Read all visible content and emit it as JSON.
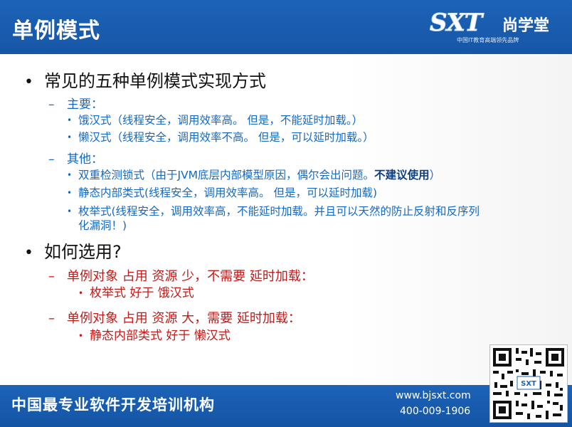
{
  "header": {
    "title": "单例模式",
    "logo_sxt": "SXT",
    "logo_cn": "尚学堂",
    "logo_tagline": "中国IT教育高端领先品牌"
  },
  "sections": [
    {
      "bullet": "常见的五种单例模式实现方式",
      "groups": [
        {
          "label": "主要：",
          "items": [
            "饿汉式（线程安全，调用效率高。 但是，不能延时加载。）",
            "懒汉式（线程安全，调用效率不高。 但是，可以延时加载。）"
          ]
        },
        {
          "label": "其他：",
          "items": [
            {
              "text": "双重检测锁式（由于JVM底层内部模型原因，偶尔会出问题。",
              "bold": "不建议使用",
              "tail": "）"
            },
            "静态内部类式(线程安全，调用效率高。 但是，可以延时加载)",
            {
              "line1": "枚举式(线程安全，调用效率高，不能延时加载。并且可以天然的防止反射和反序列",
              "line2": "化漏洞！)"
            }
          ]
        }
      ]
    },
    {
      "bullet": "如何选用?",
      "groups": [
        {
          "label": "单例对象  占用  资源 少，不需要  延时加载：",
          "items": [
            "枚举式   好于   饿汉式"
          ]
        },
        {
          "label": "单例对象  占用  资源 大，需要 延时加载：",
          "items": [
            "静态内部类式   好于   懒汉式"
          ]
        }
      ]
    }
  ],
  "footer": {
    "slogan": "中国最专业软件开发培训机构",
    "website": "www.bjsxt.com",
    "phone": "400-009-1906"
  },
  "qr": {
    "label": "SXT"
  },
  "colors": {
    "header_blue": "#1d63b8",
    "text_blue": "#1569c2",
    "text_red": "#c31a1a",
    "emphasis": "#0d3e80"
  }
}
